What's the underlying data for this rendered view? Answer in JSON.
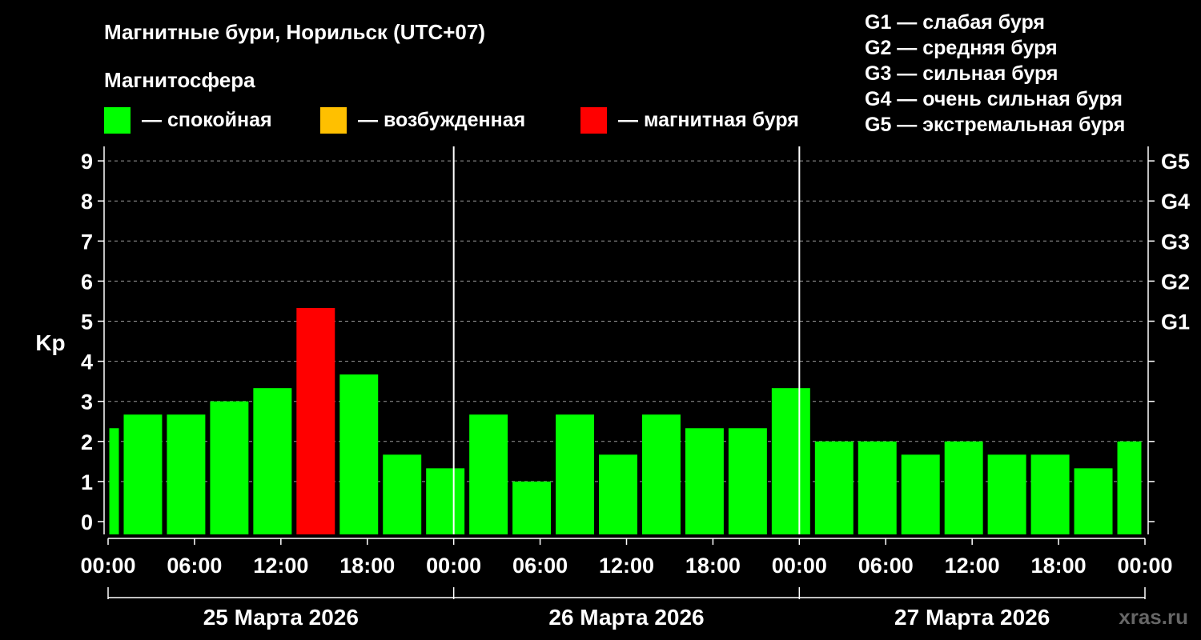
{
  "chart_data": {
    "type": "bar",
    "title": "Магнитные бури, Норильск (UTC+07)",
    "ylabel": "Kp",
    "ylim": [
      -0.3,
      9.4
    ],
    "yticks": [
      "0",
      "1",
      "2",
      "3",
      "4",
      "5",
      "6",
      "7",
      "8",
      "9"
    ],
    "right_axis": [
      {
        "label": "G1",
        "kp": 5
      },
      {
        "label": "G2",
        "kp": 6
      },
      {
        "label": "G3",
        "kp": 7
      },
      {
        "label": "G4",
        "kp": 8
      },
      {
        "label": "G5",
        "kp": 9
      }
    ],
    "xlim_hours": [
      0,
      72
    ],
    "xticks": [
      {
        "hour": 0,
        "label": "00:00"
      },
      {
        "hour": 6,
        "label": "06:00"
      },
      {
        "hour": 12,
        "label": "12:00"
      },
      {
        "hour": 18,
        "label": "18:00"
      },
      {
        "hour": 24,
        "label": "00:00"
      },
      {
        "hour": 30,
        "label": "06:00"
      },
      {
        "hour": 36,
        "label": "12:00"
      },
      {
        "hour": 42,
        "label": "18:00"
      },
      {
        "hour": 48,
        "label": "00:00"
      },
      {
        "hour": 54,
        "label": "06:00"
      },
      {
        "hour": 60,
        "label": "12:00"
      },
      {
        "hour": 66,
        "label": "18:00"
      },
      {
        "hour": 72,
        "label": "00:00"
      }
    ],
    "days": [
      {
        "label": "25 Марта 2026",
        "start_hour": 0,
        "end_hour": 24
      },
      {
        "label": "26 Марта 2026",
        "start_hour": 24,
        "end_hour": 48
      },
      {
        "label": "27 Марта 2026",
        "start_hour": 48,
        "end_hour": 72
      }
    ],
    "day_separators_hours": [
      24,
      48
    ],
    "bars": [
      {
        "start_hour": 0,
        "end_hour": 1,
        "kp": 2.33,
        "state": "quiet"
      },
      {
        "start_hour": 1,
        "end_hour": 4,
        "kp": 2.67,
        "state": "quiet"
      },
      {
        "start_hour": 4,
        "end_hour": 7,
        "kp": 2.67,
        "state": "quiet"
      },
      {
        "start_hour": 7,
        "end_hour": 10,
        "kp": 3.0,
        "state": "quiet"
      },
      {
        "start_hour": 10,
        "end_hour": 13,
        "kp": 3.33,
        "state": "quiet"
      },
      {
        "start_hour": 13,
        "end_hour": 16,
        "kp": 5.33,
        "state": "storm"
      },
      {
        "start_hour": 16,
        "end_hour": 19,
        "kp": 3.67,
        "state": "quiet"
      },
      {
        "start_hour": 19,
        "end_hour": 22,
        "kp": 1.67,
        "state": "quiet"
      },
      {
        "start_hour": 22,
        "end_hour": 25,
        "kp": 1.33,
        "state": "quiet"
      },
      {
        "start_hour": 25,
        "end_hour": 28,
        "kp": 2.67,
        "state": "quiet"
      },
      {
        "start_hour": 28,
        "end_hour": 31,
        "kp": 1.0,
        "state": "quiet"
      },
      {
        "start_hour": 31,
        "end_hour": 34,
        "kp": 2.67,
        "state": "quiet"
      },
      {
        "start_hour": 34,
        "end_hour": 37,
        "kp": 1.67,
        "state": "quiet"
      },
      {
        "start_hour": 37,
        "end_hour": 40,
        "kp": 2.67,
        "state": "quiet"
      },
      {
        "start_hour": 40,
        "end_hour": 43,
        "kp": 2.33,
        "state": "quiet"
      },
      {
        "start_hour": 43,
        "end_hour": 46,
        "kp": 2.33,
        "state": "quiet"
      },
      {
        "start_hour": 46,
        "end_hour": 49,
        "kp": 3.33,
        "state": "quiet"
      },
      {
        "start_hour": 49,
        "end_hour": 52,
        "kp": 2.0,
        "state": "quiet"
      },
      {
        "start_hour": 52,
        "end_hour": 55,
        "kp": 2.0,
        "state": "quiet"
      },
      {
        "start_hour": 55,
        "end_hour": 58,
        "kp": 1.67,
        "state": "quiet"
      },
      {
        "start_hour": 58,
        "end_hour": 61,
        "kp": 2.0,
        "state": "quiet"
      },
      {
        "start_hour": 61,
        "end_hour": 64,
        "kp": 1.67,
        "state": "quiet"
      },
      {
        "start_hour": 64,
        "end_hour": 67,
        "kp": 1.67,
        "state": "quiet"
      },
      {
        "start_hour": 67,
        "end_hour": 70,
        "kp": 1.33,
        "state": "quiet"
      },
      {
        "start_hour": 70,
        "end_hour": 72,
        "kp": 2.0,
        "state": "quiet"
      }
    ],
    "magnetosphere_legend": {
      "title": "Магнитосфера",
      "items": [
        {
          "state": "quiet",
          "label": "— спокойная",
          "color": "#00ff00"
        },
        {
          "state": "active",
          "label": "— возбужденная",
          "color": "#ffc000"
        },
        {
          "state": "storm",
          "label": "— магнитная буря",
          "color": "#ff0000"
        }
      ]
    },
    "storm_scale_legend": [
      "G1 — слабая буря",
      "G2 — средняя буря",
      "G3 — сильная буря",
      "G4 — очень сильная буря",
      "G5 — экстремальная буря"
    ],
    "grid": "dashed horizontal at 1–9",
    "watermark": "xras.ru"
  }
}
